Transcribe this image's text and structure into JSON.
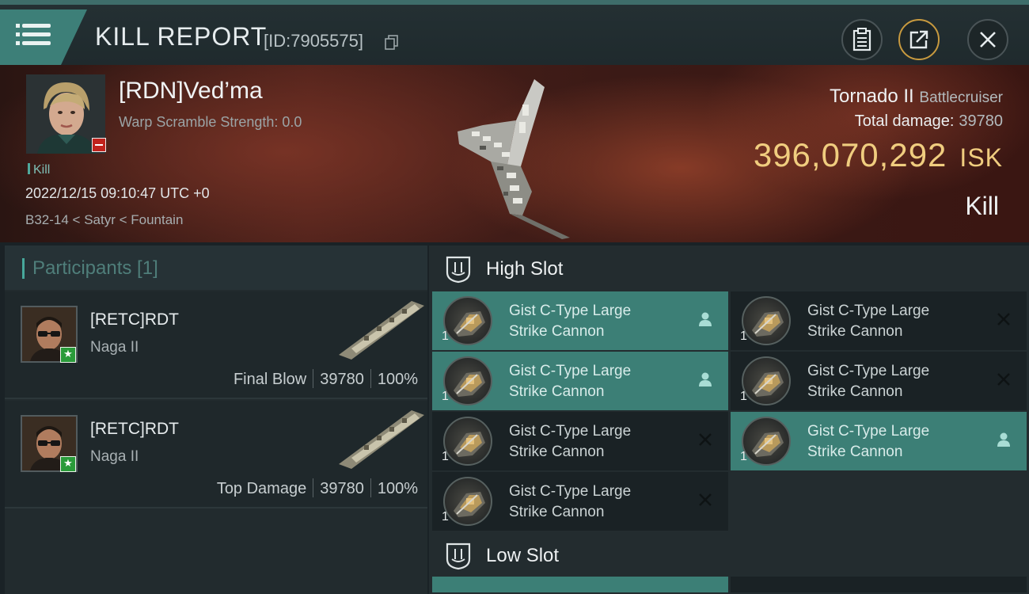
{
  "header": {
    "title": "KILL REPORT",
    "report_id": "[ID:7905575]"
  },
  "victim": {
    "name": "[RDN]Ved’ma",
    "warp_scramble": "Warp Scramble Strength: 0.0",
    "tag": "Kill",
    "datetime": "2022/12/15 09:10:47 UTC +0",
    "location": "B32-14 < Satyr < Fountain",
    "ship_name": "Tornado II",
    "ship_class": "Battlecruiser",
    "total_damage_label": "Total damage:",
    "total_damage_value": "39780",
    "isk_value": "396,070,292",
    "isk_unit": "ISK",
    "result": "Kill"
  },
  "participants": {
    "title": "Participants [1]",
    "rows": [
      {
        "name": "[RETC]RDT",
        "ship": "Naga II",
        "role": "Final Blow",
        "damage": "39780",
        "percent": "100%"
      },
      {
        "name": "[RETC]RDT",
        "ship": "Naga II",
        "role": "Top Damage",
        "damage": "39780",
        "percent": "100%"
      }
    ]
  },
  "slots": {
    "high_label": "High Slot",
    "low_label": "Low Slot",
    "high_modules": [
      {
        "line1": "Gist C-Type Large",
        "line2": "Strike Cannon",
        "qty": "1",
        "state": "fitted"
      },
      {
        "line1": "Gist C-Type Large",
        "line2": "Strike Cannon",
        "qty": "1",
        "state": "destroyed"
      },
      {
        "line1": "Gist C-Type Large",
        "line2": "Strike Cannon",
        "qty": "1",
        "state": "fitted"
      },
      {
        "line1": "Gist C-Type Large",
        "line2": "Strike Cannon",
        "qty": "1",
        "state": "destroyed"
      },
      {
        "line1": "Gist C-Type Large",
        "line2": "Strike Cannon",
        "qty": "1",
        "state": "destroyed"
      },
      {
        "line1": "Gist C-Type Large",
        "line2": "Strike Cannon",
        "qty": "1",
        "state": "fitted"
      },
      {
        "line1": "Gist C-Type Large",
        "line2": "Strike Cannon",
        "qty": "1",
        "state": "destroyed"
      }
    ]
  },
  "icons": {
    "menu": "hamburger-menu-icon",
    "copy": "copy-icon",
    "clipboard": "clipboard-icon",
    "share": "share-icon",
    "close": "close-icon",
    "fitted": "person-icon",
    "destroyed": "x-icon",
    "slot": "slot-emblem-icon"
  },
  "colors": {
    "accent_teal": "#3c7f76",
    "isk_gold": "#f0cd7f",
    "loss_red": "#c0231d",
    "star_green": "#2a9b3a"
  }
}
